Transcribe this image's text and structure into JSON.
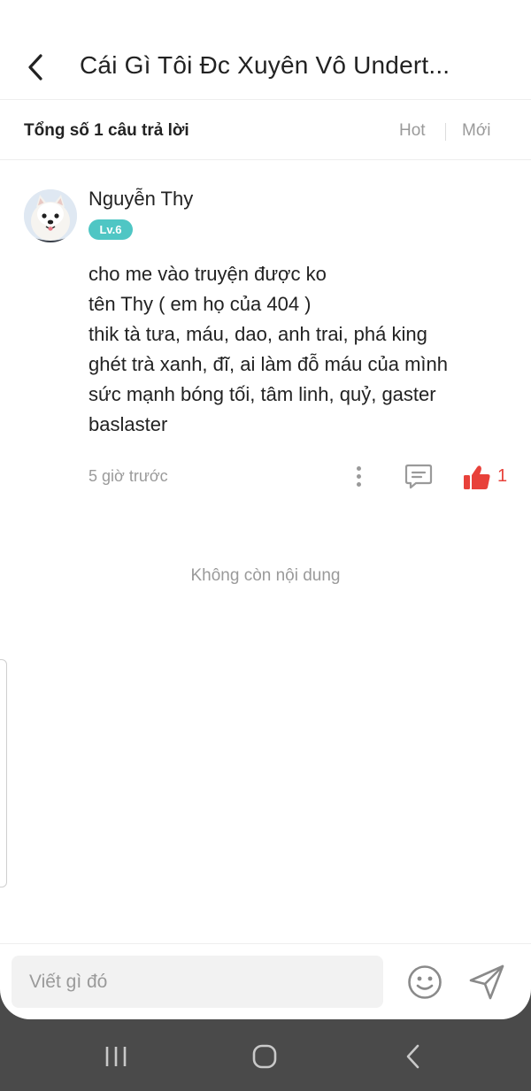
{
  "header": {
    "title": "Cái Gì Tôi Đc Xuyên Vô Undert..."
  },
  "subheader": {
    "answer_count": "Tổng số 1 câu trả lời",
    "sort_hot": "Hot",
    "sort_new": "Mới"
  },
  "post": {
    "username": "Nguyễn Thy",
    "level": "Lv.6",
    "lines": [
      "cho me vào truyện được ko",
      "tên Thy ( em họ của 404 )",
      "thik tà tưa, máu, dao, anh trai, phá king",
      "ghét trà xanh, đĩ, ai làm đỗ máu của mình",
      "sức mạnh bóng tối, tâm linh, quỷ, gaster",
      "baslaster"
    ],
    "time": "5 giờ trước",
    "like_count": "1"
  },
  "empty_text": "Không còn nội dung",
  "composer": {
    "placeholder": "Viết gì đó"
  },
  "icons": {
    "back": "back-arrow-icon",
    "more": "more-vertical-icon",
    "comment": "comment-icon",
    "like": "thumbs-up-icon",
    "emoji": "smiley-icon",
    "send": "send-icon",
    "nav_recent": "recent-apps-icon",
    "nav_home": "home-icon",
    "nav_back": "nav-back-icon"
  },
  "colors": {
    "accent_like": "#e8413a",
    "level_badge": "#4fc6c4",
    "muted_text": "#9a9a9a",
    "nav_bar": "#4a4a4a"
  }
}
